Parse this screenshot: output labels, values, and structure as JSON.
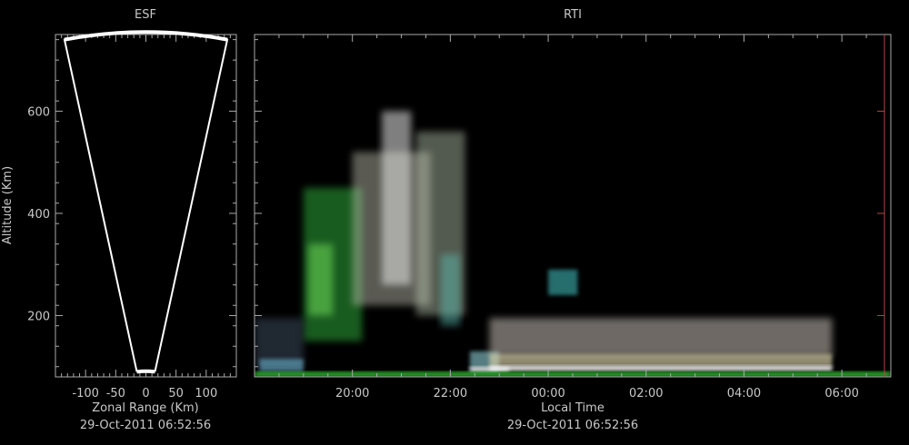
{
  "chart_data": [
    {
      "type": "heatmap",
      "title": "ESF",
      "xlabel": "Zonal Range (Km)",
      "ylabel": "Altitude (Km)",
      "timestamp": "29-Oct-2011 06:52:56",
      "xlim": [
        -150,
        150
      ],
      "ylim": [
        80,
        750
      ],
      "x_ticks": [
        "-100",
        "-50",
        "0",
        "50",
        "100"
      ],
      "x_tick_values": [
        -100,
        -50,
        0,
        50,
        100
      ],
      "y_ticks": [
        "200",
        "400",
        "600"
      ],
      "y_tick_values": [
        200,
        400,
        600
      ],
      "beam_sector": {
        "apex_altitude": 90,
        "top_altitude": 740,
        "edge_range_at_top": [
          -135,
          135
        ],
        "edge_range_at_apex": [
          -15,
          15
        ]
      },
      "colors": {
        "outline": "#ffffff",
        "background": "#000000",
        "axis": "#aaaaaa"
      }
    },
    {
      "type": "heatmap",
      "title": "RTI",
      "xlabel": "Local Time",
      "ylabel": "Altitude (Km)",
      "timestamp": "29-Oct-2011 06:52:56",
      "xlim": [
        18.0,
        31.0
      ],
      "ylim": [
        80,
        750
      ],
      "x_ticks": [
        "20:00",
        "22:00",
        "00:00",
        "02:00",
        "04:00",
        "06:00"
      ],
      "x_tick_values": [
        20,
        22,
        24,
        26,
        28,
        30
      ],
      "y_tick_values": [
        200,
        400,
        600
      ],
      "echo_regions": [
        {
          "t0": 19.0,
          "t1": 20.2,
          "a0": 150,
          "a1": 450,
          "color": "#2fa83a",
          "opacity": 0.55
        },
        {
          "t0": 19.1,
          "t1": 19.6,
          "a0": 200,
          "a1": 340,
          "color": "#6fdc58",
          "opacity": 0.55
        },
        {
          "t0": 20.0,
          "t1": 21.6,
          "a0": 220,
          "a1": 520,
          "color": "#c8c8b8",
          "opacity": 0.45
        },
        {
          "t0": 20.6,
          "t1": 21.2,
          "a0": 260,
          "a1": 600,
          "color": "#e8e8e8",
          "opacity": 0.55
        },
        {
          "t0": 21.3,
          "t1": 22.3,
          "a0": 200,
          "a1": 560,
          "color": "#b9c8b0",
          "opacity": 0.45
        },
        {
          "t0": 21.8,
          "t1": 22.2,
          "a0": 180,
          "a1": 320,
          "color": "#5fc3b8",
          "opacity": 0.45
        },
        {
          "t0": 22.4,
          "t1": 23.0,
          "a0": 90,
          "a1": 130,
          "color": "#8fd0d8",
          "opacity": 0.6
        },
        {
          "t0": 22.4,
          "t1": 23.2,
          "a0": 90,
          "a1": 100,
          "color": "#e8e0e0",
          "opacity": 0.85
        },
        {
          "t0": 22.8,
          "t1": 29.8,
          "a0": 120,
          "a1": 195,
          "color": "#b8b0a8",
          "opacity": 0.6
        },
        {
          "t0": 22.8,
          "t1": 29.8,
          "a0": 100,
          "a1": 125,
          "color": "#d8d0a8",
          "opacity": 0.65
        },
        {
          "t0": 22.8,
          "t1": 29.8,
          "a0": 92,
          "a1": 102,
          "color": "#f2f2f2",
          "opacity": 0.95
        },
        {
          "t0": 18.0,
          "t1": 19.0,
          "a0": 100,
          "a1": 195,
          "color": "#3b4a5a",
          "opacity": 0.55
        },
        {
          "t0": 18.1,
          "t1": 19.0,
          "a0": 90,
          "a1": 115,
          "color": "#6cb4d0",
          "opacity": 0.6
        },
        {
          "t0": 24.0,
          "t1": 24.6,
          "a0": 240,
          "a1": 290,
          "color": "#3fb6b8",
          "opacity": 0.6
        },
        {
          "t0": 18.0,
          "t1": 31.0,
          "a0": 80,
          "a1": 90,
          "color": "#2fbf2f",
          "opacity": 0.9
        }
      ],
      "colors": {
        "background": "#000000",
        "axis": "#aaaaaa",
        "right_axis": "#b04848"
      }
    }
  ]
}
